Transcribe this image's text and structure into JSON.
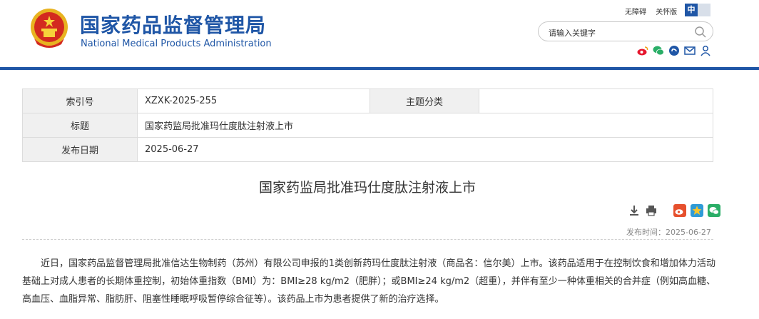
{
  "header": {
    "title_cn": "国家药品监督管理局",
    "title_en": "National Medical Products Administration",
    "accessibility_link": "无障碍",
    "care_mode_link": "关怀版",
    "lang_cn": "中",
    "lang_en": "",
    "search_placeholder": "请输入关键字",
    "icons": [
      "weibo-icon",
      "wechat-icon",
      "mini-program-icon",
      "mail-icon",
      "user-icon"
    ],
    "brand_color": "#1f56a6"
  },
  "info_table": {
    "index_label": "索引号",
    "index_value": "XZXK-2025-255",
    "category_label": "主题分类",
    "category_value": "",
    "title_label": "标题",
    "title_value": "国家药监局批准玛仕度肽注射液上市",
    "date_label": "发布日期",
    "date_value": "2025-06-27"
  },
  "article": {
    "title": "国家药监局批准玛仕度肽注射液上市",
    "publish_time": "发布时间：2025-06-27",
    "tool_icons": [
      "download-icon",
      "print-icon",
      "weibo-share-icon",
      "qzone-share-icon",
      "wechat-share-icon"
    ],
    "body": "近日，国家药品监督管理局批准信达生物制药（苏州）有限公司申报的1类创新药玛仕度肽注射液（商品名：信尔美）上市。该药品适用于在控制饮食和增加体力活动基础上对成人患者的长期体重控制，初始体重指数（BMI）为：BMI≥28 kg/m2（肥胖）；或BMI≥24 kg/m2（超重），并伴有至少一种体重相关的合并症（例如高血糖、高血压、血脂异常、脂肪肝、阻塞性睡眠呼吸暂停综合征等）。该药品上市为患者提供了新的治疗选择。"
  }
}
